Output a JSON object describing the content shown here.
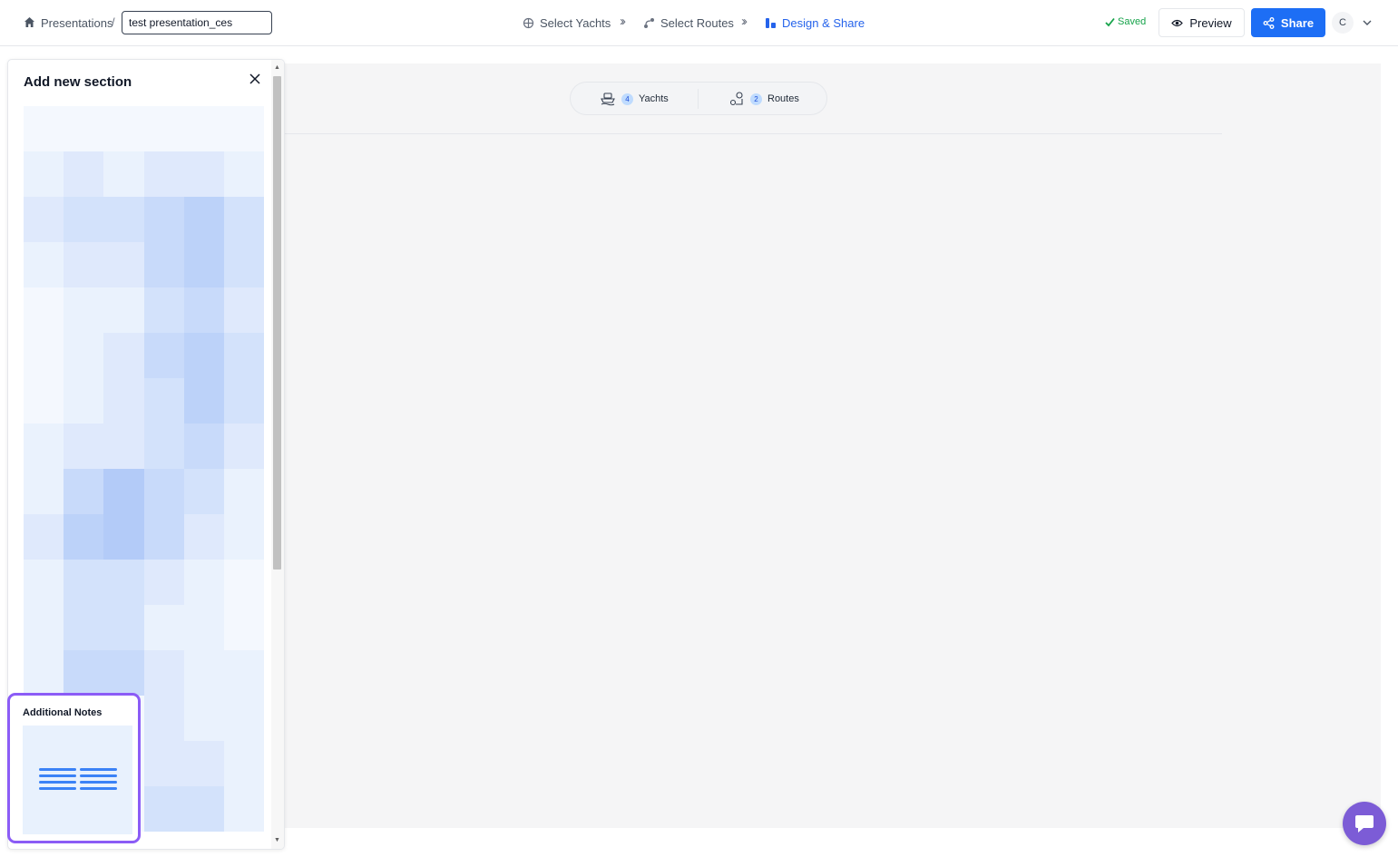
{
  "breadcrumb": {
    "home_label": "Presentations",
    "separator": "/"
  },
  "title_input": {
    "value": "test presentation_ces"
  },
  "steps": [
    {
      "label": "Select Yachts",
      "icon": "anchor-icon",
      "active": false
    },
    {
      "label": "Select Routes",
      "icon": "route-icon",
      "active": false
    },
    {
      "label": "Design & Share",
      "icon": "design-icon",
      "active": true
    }
  ],
  "status": {
    "saved_label": "Saved"
  },
  "actions": {
    "preview_label": "Preview",
    "share_label": "Share"
  },
  "user": {
    "initial": "C"
  },
  "summary": {
    "yachts": {
      "count": "4",
      "label": "Yachts"
    },
    "routes": {
      "count": "2",
      "label": "Routes"
    }
  },
  "panel": {
    "title": "Add new section",
    "card": {
      "title": "Additional Notes"
    }
  },
  "colors": {
    "accent": "#1d6ef5",
    "highlight": "#8b5cf6",
    "saved": "#16a34a"
  }
}
